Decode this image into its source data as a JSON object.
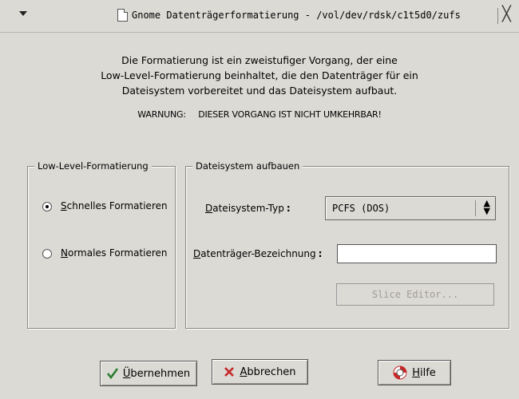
{
  "window": {
    "title": "Gnome Datenträgerformatierung - /vol/dev/rdsk/c1t5d0/zufs",
    "close_glyph": "╳"
  },
  "intro": {
    "lines": [
      "Die Formatierung ist ein zweistufiger Vorgang, der eine",
      "Low-Level-Formatierung beinhaltet, die den Datenträger für ein",
      "Dateisystem vorbereitet und das Dateisystem aufbaut."
    ],
    "warning_label": "WARNUNG:",
    "warning_text": "DIESER VORGANG IST NICHT UMKEHRBAR!"
  },
  "low_level": {
    "legend": "Low-Level-Formatierung",
    "options": [
      {
        "first": "S",
        "rest": "chnelles Formatieren",
        "checked": true
      },
      {
        "first": "N",
        "rest": "ormales Formatieren",
        "checked": false
      }
    ]
  },
  "filesystem": {
    "legend": "Dateisystem aufbauen",
    "type_label_first": "D",
    "type_label_rest": "ateisystem-Typ",
    "type_value": "PCFS (DOS)",
    "volume_label_first": "D",
    "volume_label_rest": "atenträger-Bezeichnung",
    "volume_value": "",
    "colon": ":",
    "slice_editor_label": "Slice Editor..."
  },
  "buttons": {
    "apply_first": "Ü",
    "apply_rest": "bernehmen",
    "cancel_first": "A",
    "cancel_rest": "bbrechen",
    "help_first": "H",
    "help_rest": "ilfe"
  },
  "icons": {
    "menu": "menu-arrow-icon",
    "title": "document-icon",
    "apply": "checkmark-icon",
    "cancel": "x-icon",
    "help": "lifebuoy-icon"
  }
}
